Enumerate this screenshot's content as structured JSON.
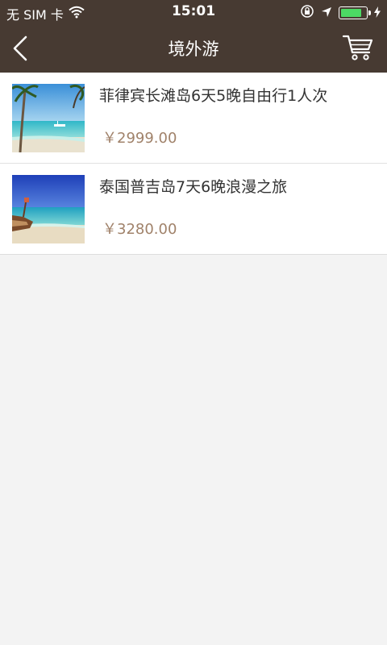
{
  "status": {
    "carrier": "无 SIM 卡",
    "time": "15:01",
    "battery_level": 0.85,
    "battery_color": "#4cd964"
  },
  "nav": {
    "title": "境外游",
    "back_icon": "chevron-left-icon",
    "cart_icon": "shopping-cart-icon",
    "bar_color": "#473a32"
  },
  "products": [
    {
      "title": "菲律宾长滩岛6天5晚自由行1人次",
      "price": "￥2999.00",
      "image": "beach-palm-photo"
    },
    {
      "title": "泰国普吉岛7天6晚浪漫之旅",
      "price": "￥3280.00",
      "image": "beach-boat-photo"
    }
  ],
  "colors": {
    "price": "#a0826a",
    "background": "#f3f3f3"
  }
}
